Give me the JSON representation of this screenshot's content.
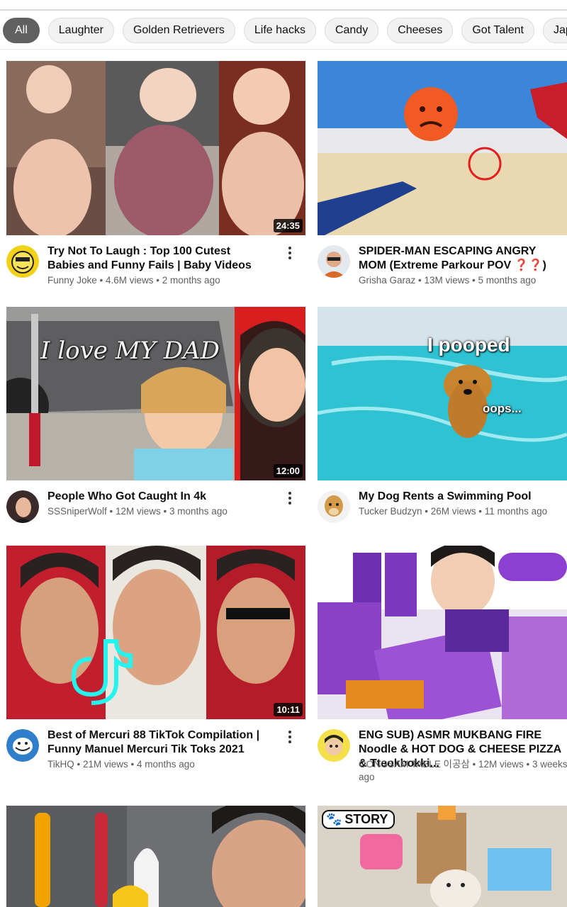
{
  "chips": [
    "All",
    "Laughter",
    "Golden Retrievers",
    "Life hacks",
    "Candy",
    "Cheeses",
    "Got Talent",
    "Jap"
  ],
  "videos": [
    {
      "title": "Try Not To Laugh : Top 100 Cutest Babies and Funny Fails | Baby Videos",
      "channel": "Funny Joke",
      "stats": "4.6M views • 2 months ago",
      "duration": "24:35",
      "avatar_icon": "yellow-cartoon-face-icon",
      "thumb_colors": [
        "#c9a28a",
        "#8f6a55",
        "#e8c4b0"
      ]
    },
    {
      "title": "SPIDER-MAN ESCAPING ANGRY MOM (Extreme Parkour POV ❓❓)",
      "channel": "Grisha Garaz",
      "stats": "13M views • 5 months ago",
      "duration": "",
      "avatar_icon": "person-sunglasses-icon",
      "thumb_colors": [
        "#2f7fd8",
        "#e9d9b4",
        "#1c3a7a"
      ]
    },
    {
      "title": "People Who Got Caught In 4k",
      "channel": "SSSniperWolf",
      "stats": "12M views • 3 months ago",
      "duration": "12:00",
      "avatar_icon": "woman-portrait-icon",
      "thumb_colors": [
        "#6e6e70",
        "#f2c6a8",
        "#d91f1f"
      ],
      "overlay": "I love MY DAD"
    },
    {
      "title": "My Dog Rents a Swimming Pool",
      "channel": "Tucker Budzyn",
      "stats": "26M views • 11 months ago",
      "duration": "",
      "avatar_icon": "golden-dog-icon",
      "thumb_colors": [
        "#3cc6d6",
        "#8fe3ea",
        "#c07a2c"
      ],
      "overlay": "I pooped",
      "overlay2": "oops..."
    },
    {
      "title": "Best of Mercuri 88 TikTok Compilation | Funny Manuel Mercuri Tik Toks 2021",
      "channel": "TikHQ",
      "stats": "21M views • 4 months ago",
      "duration": "10:11",
      "avatar_icon": "troll-face-icon",
      "thumb_colors": [
        "#b91d2a",
        "#d8a47f",
        "#2b2b2b"
      ]
    },
    {
      "title": "ENG SUB) ASMR MUKBANG FIRE Noodle & HOT DOG & CHEESE PIZZA & Tteokbokki...",
      "channel": "GONGSAM TABLE 이공삼",
      "stats_line1": "12M views • 3 weeks",
      "stats_line2": "ago",
      "duration": "",
      "avatar_icon": "cartoon-boy-icon",
      "thumb_colors": [
        "#7b3fb5",
        "#b57ad8",
        "#f0d24a"
      ]
    },
    {
      "title": "",
      "thumb_colors": [
        "#f0a500",
        "#ffffff",
        "#3a2a24"
      ]
    },
    {
      "title": "",
      "badge": "STORY",
      "thumb_colors": [
        "#d8d2c4",
        "#f2a13a",
        "#e9e9e9"
      ]
    }
  ]
}
